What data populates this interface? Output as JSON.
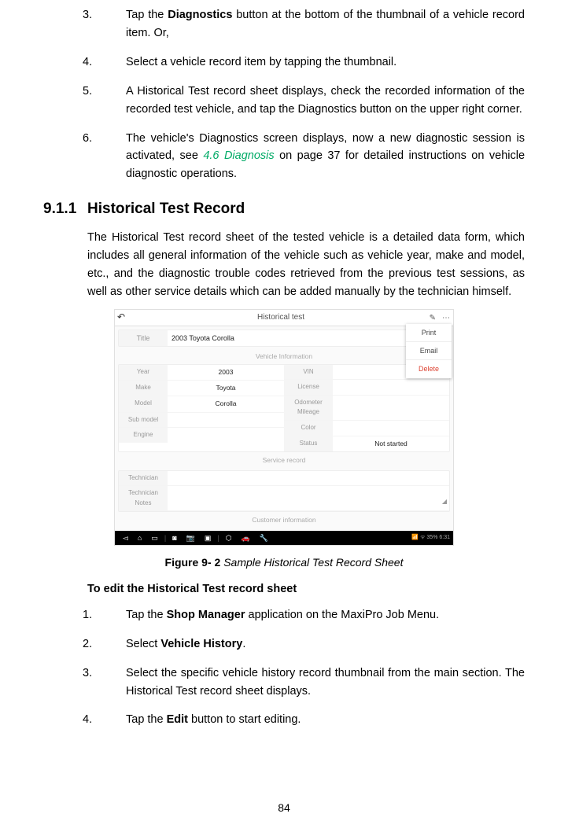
{
  "list_top": [
    {
      "n": "3.",
      "t_parts": [
        "Tap the ",
        "Diagnostics",
        " button at the bottom of the thumbnail of a vehicle record item. Or,"
      ]
    },
    {
      "n": "4.",
      "t": "Select a vehicle record item by tapping the thumbnail."
    },
    {
      "n": "5.",
      "t": "A Historical Test record sheet displays, check the recorded information of the recorded test vehicle, and tap the Diagnostics button on the upper right corner."
    },
    {
      "n": "6.",
      "t_parts": [
        "The vehicle's Diagnostics screen displays, now a new diagnostic session is activated, see ",
        "4.6 Diagnosis",
        " on page 37 for detailed instructions on vehicle diagnostic operations."
      ]
    }
  ],
  "section": {
    "num": "9.1.1",
    "title": "Historical Test Record"
  },
  "para": "The Historical Test record sheet of the tested vehicle is a detailed data form, which includes all general information of the vehicle such as vehicle year, make and model, etc., and the diagnostic trouble codes retrieved from the previous test sessions, as well as other service details which can be added manually by the technician himself.",
  "figure": {
    "header_title": "Historical test",
    "popup": [
      "Print",
      "Email",
      "Delete"
    ],
    "title_lbl": "Title",
    "title_val": "2003 Toyota Corolla",
    "section_vehicle": "Vehicle Information",
    "left": [
      {
        "lbl": "Year",
        "val": "2003"
      },
      {
        "lbl": "Make",
        "val": "Toyota"
      },
      {
        "lbl": "Model",
        "val": "Corolla"
      },
      {
        "lbl": "Sub model",
        "val": ""
      },
      {
        "lbl": "Engine",
        "val": ""
      }
    ],
    "right": [
      {
        "lbl": "VIN",
        "val": ""
      },
      {
        "lbl": "License",
        "val": ""
      },
      {
        "lbl": "Odometer Mileage",
        "val": ""
      },
      {
        "lbl": "Color",
        "val": ""
      },
      {
        "lbl": "Status",
        "val": "Not started"
      }
    ],
    "section_service": "Service record",
    "service": [
      {
        "lbl": "Technician",
        "val": ""
      },
      {
        "lbl": "Technician Notes",
        "val": ""
      }
    ],
    "section_cust": "Customer information",
    "status_time": "35% 6:31"
  },
  "caption": {
    "num": "Figure 9- 2 ",
    "txt": "Sample Historical Test Record Sheet"
  },
  "sub_head": "To edit the Historical Test record sheet",
  "list_bottom": [
    {
      "n": "1.",
      "t_parts": [
        "Tap the ",
        "Shop Manager",
        " application on the MaxiPro Job Menu."
      ]
    },
    {
      "n": "2.",
      "t_parts": [
        "Select ",
        "Vehicle History",
        "."
      ]
    },
    {
      "n": "3.",
      "t": "Select the specific vehicle history record thumbnail from the main section. The Historical Test record sheet displays."
    },
    {
      "n": "4.",
      "t_parts": [
        "Tap the ",
        "Edit",
        " button to start editing."
      ]
    }
  ],
  "page": "84"
}
